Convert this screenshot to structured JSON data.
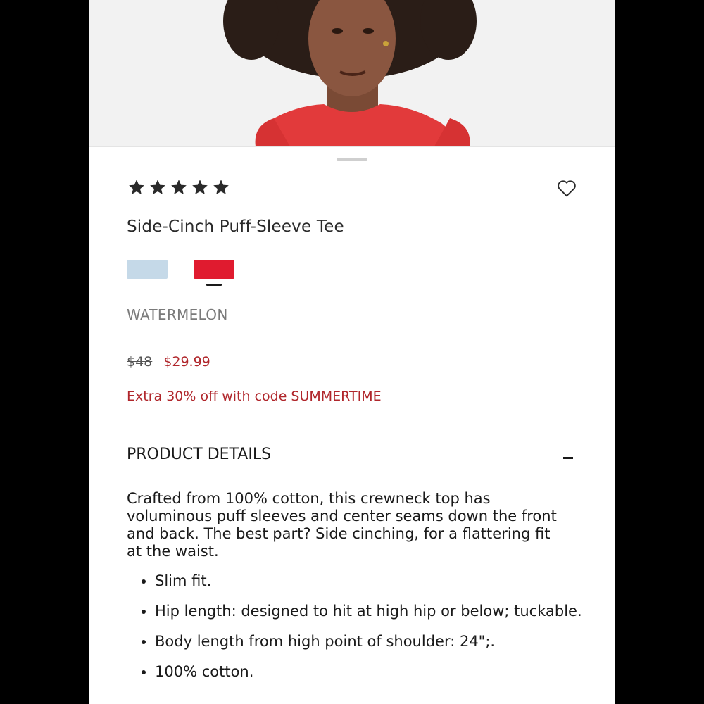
{
  "product": {
    "rating_stars": 5,
    "title": "Side-Cinch Puff-Sleeve Tee",
    "colors": [
      {
        "name": "light blue",
        "hex": "#c5d9e8"
      },
      {
        "name": "WATERMELON",
        "hex": "#e01b2f"
      }
    ],
    "selected_color": "WATERMELON",
    "original_price": "$48",
    "sale_price": "$29.99",
    "promo": "Extra 30% off with code SUMMERTIME"
  },
  "details": {
    "heading": "PRODUCT DETAILS",
    "description": "Crafted from 100% cotton, this crewneck top has voluminous puff sleeves and center seams down the front and back. The best part? Side cinching, for a flattering fit at the waist.",
    "bullets": [
      "Slim fit.",
      "Hip length: designed to hit at high hip or below; tuckable.",
      "Body length from high point of shoulder: 24\";.",
      "100% cotton."
    ]
  },
  "icons": {
    "favorite": "heart-outline-icon",
    "collapse": "minus-icon",
    "rating": "star-icon"
  },
  "colors_ui": {
    "accent_red": "#b0262b",
    "text": "#1a1a1a"
  }
}
